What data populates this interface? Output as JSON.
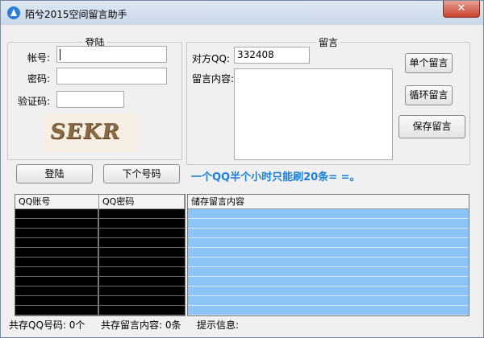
{
  "window": {
    "title": "陌兮2015空间留言助手",
    "close_glyph": "✕"
  },
  "login": {
    "legend": "登陆",
    "account_label": "帐号:",
    "password_label": "密码:",
    "captcha_label": "验证码:",
    "account_value": "",
    "password_value": "",
    "captcha_value": "",
    "captcha_image_text": "SEKR",
    "login_button": "登陆",
    "next_button": "下个号码"
  },
  "message": {
    "legend": "留言",
    "target_qq_label": "对方QQ:",
    "target_qq_value": "332408",
    "content_label": "留言内容:",
    "content_value": "",
    "single_button": "单个留言",
    "loop_button": "循环留言",
    "save_button": "保存留言"
  },
  "hint_text": "一个QQ半个小时只能刷20条= =。",
  "accounts_table": {
    "columns": [
      "QQ账号",
      "QQ密码"
    ],
    "rows": []
  },
  "saved_table": {
    "columns": [
      "储存留言内容"
    ],
    "rows": []
  },
  "status": {
    "qq_count": "共存QQ号码: 0个",
    "message_count": "共存留言内容: 0条",
    "info_label": "提示信息:"
  },
  "colors": {
    "hint": "#1a7fd8",
    "saved_rows": "#8ec3f5",
    "accounts_bg": "#000000"
  }
}
